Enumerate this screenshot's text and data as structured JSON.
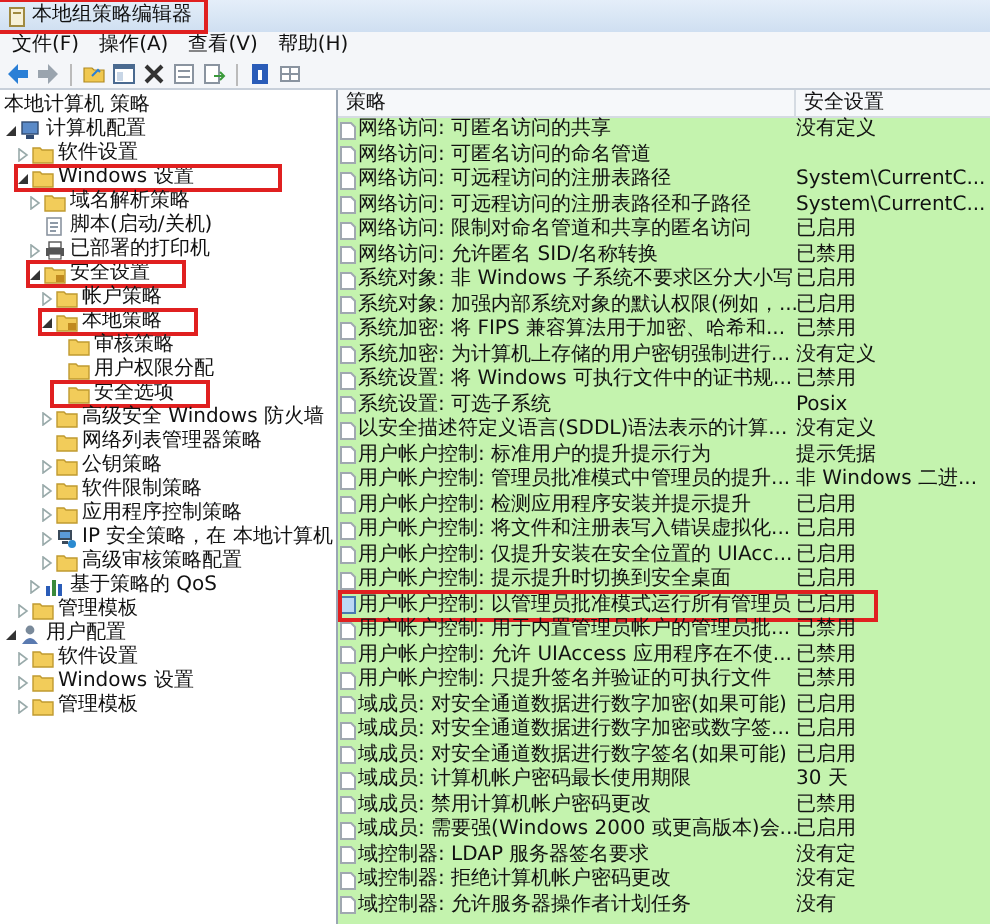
{
  "window": {
    "title": "本地组策略编辑器",
    "highlighted": true
  },
  "menu": [
    "文件(F)",
    "操作(A)",
    "查看(V)",
    "帮助(H)"
  ],
  "tree": {
    "root": "本地计算机 策略",
    "items": [
      {
        "label": "计算机配置",
        "kind": "computer",
        "expanded": true,
        "highlighted": false,
        "children": [
          {
            "label": "软件设置",
            "kind": "folder",
            "expanded": false,
            "highlighted": false
          },
          {
            "label": "Windows 设置",
            "kind": "folder",
            "expanded": true,
            "highlighted": true,
            "children": [
              {
                "label": "域名解析策略",
                "kind": "folder",
                "expanded": false,
                "highlighted": false
              },
              {
                "label": "脚本(启动/关机)",
                "kind": "script",
                "highlighted": false
              },
              {
                "label": "已部署的打印机",
                "kind": "printer",
                "expanded": false,
                "highlighted": false
              },
              {
                "label": "安全设置",
                "kind": "secure-folder",
                "expanded": true,
                "highlighted": true,
                "children": [
                  {
                    "label": "帐户策略",
                    "kind": "folder",
                    "expanded": false,
                    "highlighted": false
                  },
                  {
                    "label": "本地策略",
                    "kind": "secure-folder",
                    "expanded": true,
                    "highlighted": true,
                    "children": [
                      {
                        "label": "审核策略",
                        "kind": "folder",
                        "highlighted": false
                      },
                      {
                        "label": "用户权限分配",
                        "kind": "folder",
                        "highlighted": false
                      },
                      {
                        "label": "安全选项",
                        "kind": "folder",
                        "highlighted": true
                      }
                    ]
                  },
                  {
                    "label": "高级安全 Windows 防火墙",
                    "kind": "folder",
                    "expanded": false,
                    "highlighted": false
                  },
                  {
                    "label": "网络列表管理器策略",
                    "kind": "folder",
                    "highlighted": false
                  },
                  {
                    "label": "公钥策略",
                    "kind": "folder",
                    "expanded": false,
                    "highlighted": false
                  },
                  {
                    "label": "软件限制策略",
                    "kind": "folder",
                    "expanded": false,
                    "highlighted": false
                  },
                  {
                    "label": "应用程序控制策略",
                    "kind": "folder",
                    "expanded": false,
                    "highlighted": false
                  },
                  {
                    "label": "IP 安全策略，在 本地计算机",
                    "kind": "network",
                    "expanded": false,
                    "highlighted": false
                  },
                  {
                    "label": "高级审核策略配置",
                    "kind": "folder",
                    "expanded": false,
                    "highlighted": false
                  }
                ]
              },
              {
                "label": "基于策略的 QoS",
                "kind": "chart",
                "expanded": false,
                "highlighted": false
              }
            ]
          },
          {
            "label": "管理模板",
            "kind": "folder",
            "expanded": false,
            "highlighted": false
          }
        ]
      },
      {
        "label": "用户配置",
        "kind": "user",
        "expanded": true,
        "highlighted": false,
        "children": [
          {
            "label": "软件设置",
            "kind": "folder",
            "expanded": false,
            "highlighted": false
          },
          {
            "label": "Windows 设置",
            "kind": "folder",
            "expanded": false,
            "highlighted": false
          },
          {
            "label": "管理模板",
            "kind": "folder",
            "expanded": false,
            "highlighted": false
          }
        ]
      }
    ]
  },
  "table": {
    "columns": [
      "策略",
      "安全设置"
    ],
    "rows": [
      {
        "policy": "网络访问: 可匿名访问的共享",
        "setting": "没有定义",
        "highlighted": false
      },
      {
        "policy": "网络访问: 可匿名访问的命名管道",
        "highlighted": false
      },
      {
        "policy": "网络访问: 可远程访问的注册表路径",
        "setting": "System\\CurrentC...",
        "highlighted": false
      },
      {
        "policy": "网络访问: 可远程访问的注册表路径和子路径",
        "setting": "System\\CurrentC...",
        "highlighted": false
      },
      {
        "policy": "网络访问: 限制对命名管道和共享的匿名访问",
        "setting": "已启用",
        "highlighted": false
      },
      {
        "policy": "网络访问: 允许匿名 SID/名称转换",
        "setting": "已禁用",
        "highlighted": false
      },
      {
        "policy": "系统对象: 非 Windows 子系统不要求区分大小写",
        "setting": "已启用",
        "highlighted": false
      },
      {
        "policy": "系统对象: 加强内部系统对象的默认权限(例如，...",
        "setting": "已启用",
        "highlighted": false
      },
      {
        "policy": "系统加密: 将 FIPS 兼容算法用于加密、哈希和...",
        "setting": "已禁用",
        "highlighted": false
      },
      {
        "policy": "系统加密: 为计算机上存储的用户密钥强制进行...",
        "setting": "没有定义",
        "highlighted": false
      },
      {
        "policy": "系统设置: 将 Windows 可执行文件中的证书规...",
        "setting": "已禁用",
        "highlighted": false
      },
      {
        "policy": "系统设置: 可选子系统",
        "setting": "Posix",
        "highlighted": false
      },
      {
        "policy": "以安全描述符定义语言(SDDL)语法表示的计算...",
        "setting": "没有定义",
        "highlighted": false
      },
      {
        "policy": "用户帐户控制: 标准用户的提升提示行为",
        "setting": "提示凭据",
        "highlighted": false
      },
      {
        "policy": "用户帐户控制: 管理员批准模式中管理员的提升...",
        "setting": "非 Windows 二进...",
        "highlighted": false
      },
      {
        "policy": "用户帐户控制: 检测应用程序安装并提示提升",
        "setting": "已启用",
        "highlighted": false
      },
      {
        "policy": "用户帐户控制: 将文件和注册表写入错误虚拟化...",
        "setting": "已启用",
        "highlighted": false
      },
      {
        "policy": "用户帐户控制: 仅提升安装在安全位置的 UIAcc...",
        "setting": "已启用",
        "highlighted": false
      },
      {
        "policy": "用户帐户控制: 提示提升时切换到安全桌面",
        "setting": "已启用",
        "highlighted": false
      },
      {
        "policy": "用户帐户控制: 以管理员批准模式运行所有管理员",
        "setting": "已启用",
        "highlighted": true
      },
      {
        "policy": "用户帐户控制: 用于内置管理员帐户的管理员批...",
        "setting": "已禁用",
        "highlighted": false
      },
      {
        "policy": "用户帐户控制: 允许 UIAccess 应用程序在不使...",
        "setting": "已禁用",
        "highlighted": false
      },
      {
        "policy": "用户帐户控制: 只提升签名并验证的可执行文件",
        "setting": "已禁用",
        "highlighted": false
      },
      {
        "policy": "域成员: 对安全通道数据进行数字加密(如果可能)",
        "setting": "已启用",
        "highlighted": false
      },
      {
        "policy": "域成员: 对安全通道数据进行数字加密或数字签...",
        "setting": "已启用",
        "highlighted": false
      },
      {
        "policy": "域成员: 对安全通道数据进行数字签名(如果可能)",
        "setting": "已启用",
        "highlighted": false
      },
      {
        "policy": "域成员: 计算机帐户密码最长使用期限",
        "setting": "30 天",
        "highlighted": false
      },
      {
        "policy": "域成员: 禁用计算机帐户密码更改",
        "setting": "已禁用",
        "highlighted": false
      },
      {
        "policy": "域成员: 需要强(Windows 2000 或更高版本)会...",
        "setting": "已启用",
        "highlighted": false
      },
      {
        "policy": "域控制器: LDAP 服务器签名要求",
        "setting": "没有定",
        "highlighted": false
      },
      {
        "policy": "域控制器: 拒绝计算机帐户密码更改",
        "setting": "没有定",
        "highlighted": false
      },
      {
        "policy": "域控制器: 允许服务器操作者计划任务",
        "setting": "没有",
        "highlighted": false
      }
    ]
  }
}
